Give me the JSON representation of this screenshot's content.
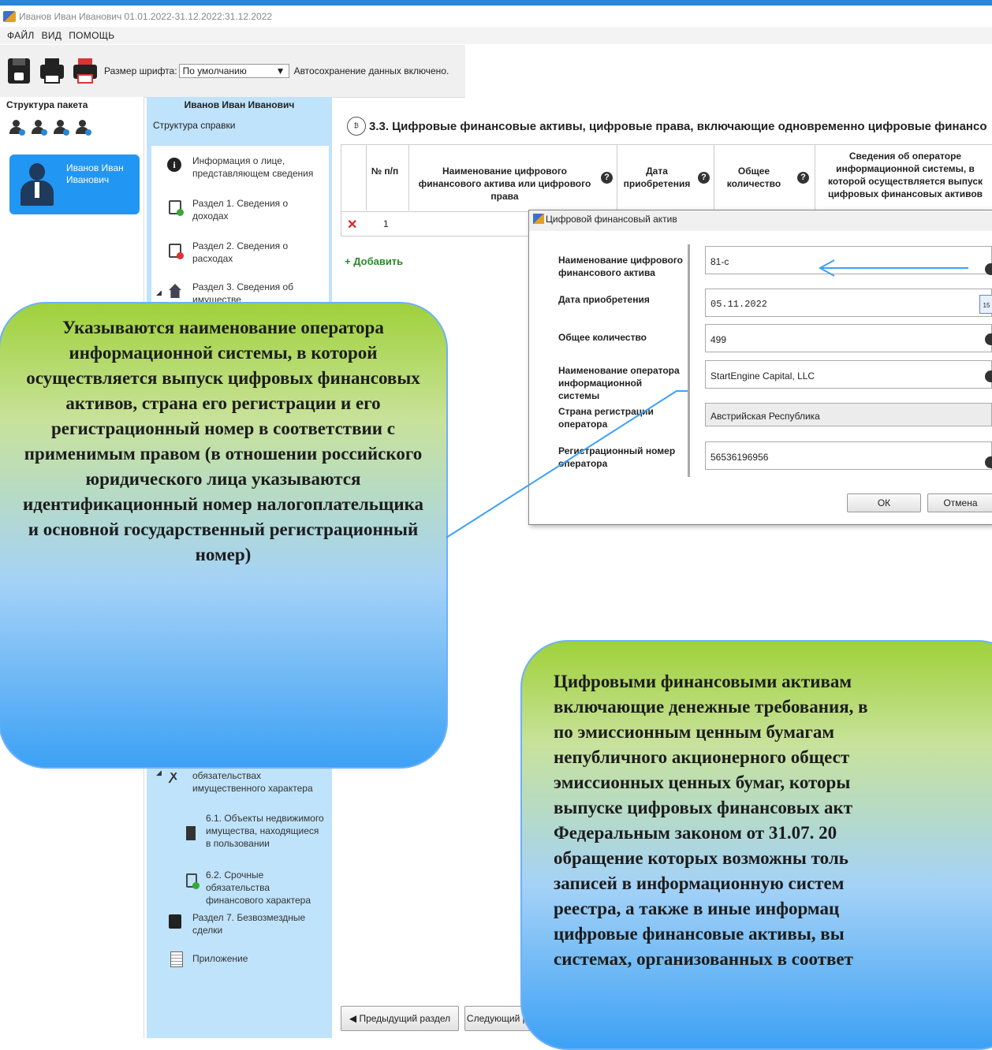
{
  "window": {
    "title": "Иванов Иван Иванович 01.01.2022-31.12.2022:31.12.2022"
  },
  "menu": [
    "ФАЙЛ",
    "ВИД",
    "ПОМОЩЬ"
  ],
  "toolbar": {
    "font_label": "Размер шрифта:",
    "font_value": "По умолчанию",
    "autosave": "Автосохранение данных включено.",
    "icons": [
      "save-icon",
      "print-icon",
      "print-red-icon"
    ]
  },
  "left": {
    "title": "Структура пакета",
    "user": "Иванов Иван Иванович"
  },
  "nav": {
    "title": "Иванов Иван Иванович",
    "subtitle": "Структура справки",
    "items": [
      {
        "label": "Информация о лице, представляющем сведения",
        "icon": "info-icon"
      },
      {
        "label": "Раздел 1. Сведения о доходах",
        "icon": "doc-plus-icon"
      },
      {
        "label": "Раздел 2. Сведения о расходах",
        "icon": "doc-minus-icon"
      },
      {
        "label": "Раздел 3. Сведения об имуществе",
        "icon": "house-icon"
      },
      {
        "label": "обязательствах имущественного характера",
        "icon": "run-icon"
      },
      {
        "label": "6.1. Объекты недвижимого имущества, находящиеся в пользовании",
        "icon": "building-icon"
      },
      {
        "label": "6.2. Срочные обязательства финансового характера",
        "icon": "doc-icon"
      },
      {
        "label": "Раздел 7. Безвозмездные сделки",
        "icon": "gift-icon"
      },
      {
        "label": "Приложение",
        "icon": "sheet-icon"
      }
    ]
  },
  "main": {
    "section_title": "3.3. Цифровые финансовые активы, цифровые права, включающие одновременно цифровые финансо",
    "columns": [
      "№ п/п",
      "Наименование цифрового финансового актива или цифрового права",
      "Дата приобретения",
      "Общее количество",
      "Сведения об операторе информационной системы, в которой осуществляется выпуск цифровых финансовых активов"
    ],
    "rows": [
      {
        "num": "1"
      }
    ],
    "add_label": "+ Добавить",
    "prev_label": "◀  Предыдущий раздел",
    "next_label": "Следующий разд"
  },
  "dialog": {
    "title": "Цифровой финансовый актив",
    "fields": [
      {
        "label": "Наименование цифрового финансового актива",
        "value": "81-с"
      },
      {
        "label": "Дата приобретения",
        "value": "05.11.2022"
      },
      {
        "label": "Общее количество",
        "value": "499"
      },
      {
        "label": "Наименование оператора информационной системы",
        "value": "StartEngine Capital, LLC"
      },
      {
        "label": "Страна регистрации оператора",
        "value": "Австрийская Республика"
      },
      {
        "label": "Регистрационный номер оператора",
        "value": "56536196956"
      }
    ],
    "ok": "ОК",
    "cancel": "Отмена"
  },
  "annotations": {
    "left": "Указываются наименование оператора информационной системы, в которой осуществляется выпуск цифровых финансовых активов, страна его регистрации и его регистрационный номер в соответствии с применимым правом (в отношении российского юридического лица указываются идентификационный номер налогоплательщика и основной государственный регистрационный номер)",
    "right_lines": [
      "Цифровыми финансовыми активам",
      "включающие денежные требования, в",
      "по эмиссионным ценным бумагам",
      "непубличного акционерного общест",
      "эмиссионных ценных бумаг, которы",
      "выпуске цифровых финансовых акт",
      "Федеральным законом от 31.07. 20",
      "обращение которых возможны толь",
      "записей в информационную систем",
      "реестра, а также в иные информац",
      "цифровые финансовые активы, вы",
      "системах, организованных в соответ"
    ]
  },
  "colors": {
    "accent": "#2196f3",
    "nav_bg": "#bfe3fb",
    "bubble_top": "#9fd13a",
    "bubble_bottom": "#3da1f5"
  }
}
